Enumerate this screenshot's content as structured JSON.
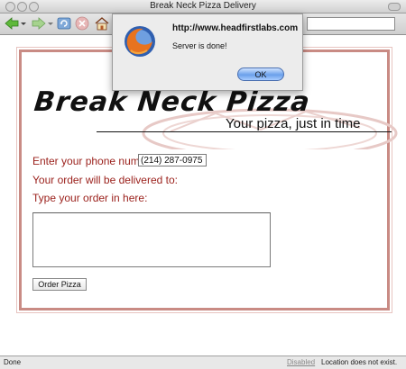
{
  "window": {
    "title": "Break Neck Pizza Delivery"
  },
  "page": {
    "logo": "Break Neck Pizza",
    "tagline": "Your pizza, just in time",
    "phone_label": "Enter your phone number:",
    "phone_value": "(214) 287-0975",
    "delivery_label": "Your order will be delivered to:",
    "order_label": "Type your order in here:",
    "order_value": "",
    "order_button": "Order Pizza"
  },
  "dialog": {
    "title": "http://www.headfirstlabs.com",
    "message": "Server is done!",
    "ok_label": "OK"
  },
  "status": {
    "left": "Done",
    "disabled": "Disabled",
    "right": "Location does not exist."
  },
  "colors": {
    "frame_border": "#c98b84",
    "form_text": "#9a1f1a",
    "ok_button": "#6aa0ea"
  }
}
